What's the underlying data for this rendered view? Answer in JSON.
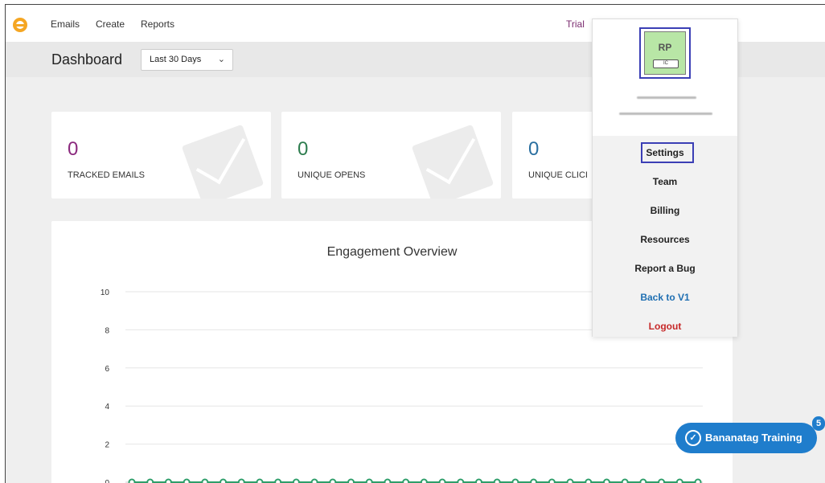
{
  "navbar": {
    "links": [
      "Emails",
      "Create",
      "Reports"
    ],
    "trial_label": "Trial"
  },
  "header": {
    "title": "Dashboard",
    "range": "Last 30 Days"
  },
  "stats": [
    {
      "value": "0",
      "label": "TRACKED EMAILS",
      "color": "#8b2a7e"
    },
    {
      "value": "0",
      "label": "UNIQUE OPENS",
      "color": "#2e7d4f"
    },
    {
      "value": "0",
      "label": "UNIQUE CLICI",
      "color": "#2a6fa0"
    }
  ],
  "profile": {
    "initials": "RP",
    "badge": "IC"
  },
  "menu": {
    "settings": "Settings",
    "team": "Team",
    "billing": "Billing",
    "resources": "Resources",
    "report_bug": "Report a Bug",
    "back_v1": "Back to V1",
    "logout": "Logout",
    "link_color": "#1f6fb2",
    "logout_color": "#c62828"
  },
  "training": {
    "label": "Bananatag Training",
    "count": "5"
  },
  "chart_data": {
    "type": "line",
    "title": "Engagement Overview",
    "xlabel": "",
    "ylabel": "",
    "ylim": [
      0,
      10
    ],
    "yticks": [
      "10",
      "8",
      "6",
      "4",
      "2",
      "0"
    ],
    "series": [
      {
        "values": [
          0,
          0,
          0,
          0,
          0,
          0,
          0,
          0,
          0,
          0,
          0,
          0,
          0,
          0,
          0,
          0,
          0,
          0,
          0,
          0,
          0,
          0,
          0,
          0,
          0,
          0,
          0,
          0,
          0,
          0,
          0,
          0
        ],
        "color": "#2e9e6a"
      }
    ],
    "grid": true
  }
}
